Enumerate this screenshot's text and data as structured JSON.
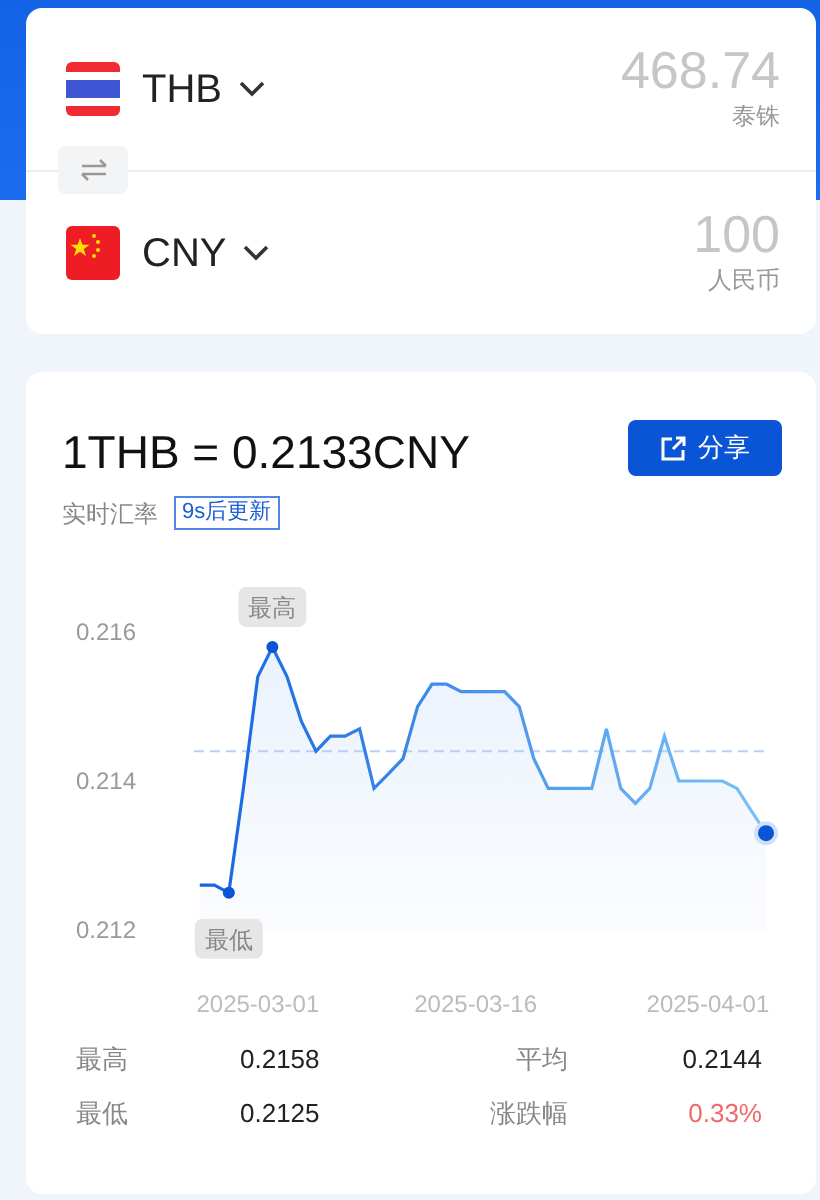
{
  "converter": {
    "currencies": [
      {
        "kind": "th",
        "code": "THB",
        "amount": "468.74",
        "name": "泰铢"
      },
      {
        "kind": "cn",
        "code": "CNY",
        "amount": "100",
        "name": "人民币"
      }
    ]
  },
  "rate": {
    "title": "1THB = 0.2133CNY",
    "label": "实时汇率",
    "badge": "9s后更新",
    "share_button": "分享",
    "chart_data": {
      "type": "area",
      "categories": [
        null,
        null,
        null,
        null,
        "2025-03-01",
        null,
        null,
        null,
        null,
        null,
        null,
        null,
        null,
        null,
        null,
        null,
        null,
        null,
        null,
        "2025-03-16",
        null,
        null,
        null,
        null,
        null,
        null,
        null,
        null,
        null,
        null,
        null,
        null,
        null,
        null,
        null,
        "2025-04-01",
        null,
        null,
        null,
        null
      ],
      "series": [
        {
          "color": "#1565e0",
          "values": [
            0.2126,
            0.2126,
            0.2125,
            0.2139,
            0.2154,
            0.2158,
            0.2154,
            0.2148,
            0.2144,
            0.2146,
            0.2146,
            0.2147,
            0.2139,
            0.2141,
            0.2143,
            0.215,
            0.2153,
            0.2153,
            0.2152,
            0.2152,
            0.2152,
            0.2152,
            0.215,
            0.2143,
            0.2139,
            0.2139,
            0.2139,
            0.2139,
            0.2147,
            0.2139,
            0.2137,
            0.2139,
            0.2146,
            0.214,
            0.214,
            0.214,
            0.214,
            0.2139,
            0.2136,
            0.2133
          ]
        }
      ],
      "ylim": [
        0.212,
        0.216
      ],
      "yticks": [
        {
          "value": 0.212,
          "label": "0.212"
        },
        {
          "value": 0.214,
          "label": "0.214"
        },
        {
          "value": 0.216,
          "label": "0.216"
        }
      ],
      "ref_lines": [
        {
          "axis": "y",
          "value": 0.2144
        }
      ],
      "annotations": [
        {
          "y": 0.2158,
          "text": "最高"
        },
        {
          "y": 0.2125,
          "text": "最低"
        }
      ]
    }
  },
  "stats": [
    {
      "label": "最高",
      "value": "0.2158",
      "kind": "plain"
    },
    {
      "label": "平均",
      "value": "0.2144",
      "kind": "plain"
    },
    {
      "label": "最低",
      "value": "0.2125",
      "kind": "plain"
    },
    {
      "label": "涨跌幅",
      "value": "0.33%",
      "kind": "change"
    }
  ]
}
